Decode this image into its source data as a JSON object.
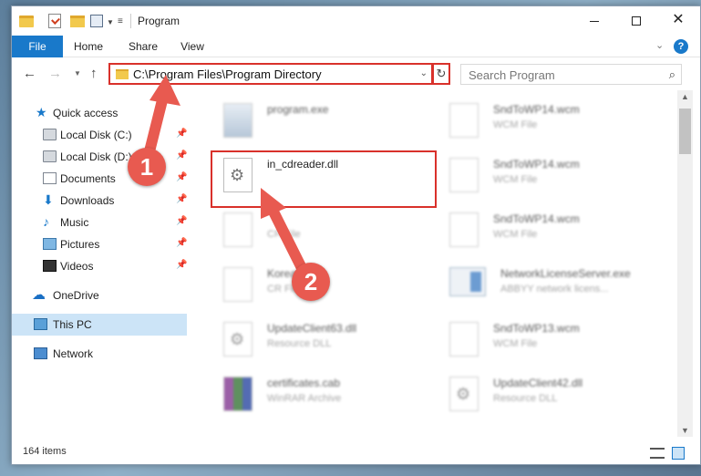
{
  "window": {
    "title": "Program"
  },
  "ribbon": {
    "tabs": [
      "File",
      "Home",
      "Share",
      "View"
    ]
  },
  "nav": {
    "address": "C:\\Program Files\\Program Directory",
    "search_placeholder": "Search Program"
  },
  "sidebar": {
    "items": [
      {
        "label": "Quick access"
      },
      {
        "label": "Local Disk (C:)"
      },
      {
        "label": "Local Disk (D:)"
      },
      {
        "label": "Documents"
      },
      {
        "label": "Downloads"
      },
      {
        "label": "Music"
      },
      {
        "label": "Pictures"
      },
      {
        "label": "Videos"
      },
      {
        "label": "OneDrive"
      },
      {
        "label": "This PC"
      },
      {
        "label": "Network"
      }
    ]
  },
  "files": [
    {
      "name": "program.exe",
      "type": ""
    },
    {
      "name": "SndToWP14.wcm",
      "type": "WCM File"
    },
    {
      "name": "in_cdreader.dll",
      "type": ""
    },
    {
      "name": "SndToWP14.wcm",
      "type": "WCM File"
    },
    {
      "name": "",
      "type": "CR File"
    },
    {
      "name": "SndToWP14.wcm",
      "type": "WCM File"
    },
    {
      "name": "Korean",
      "type": "CR File"
    },
    {
      "name": "NetworkLicenseServer.exe",
      "type": "ABBYY network licens..."
    },
    {
      "name": "UpdateClient63.dll",
      "type": "Resource DLL"
    },
    {
      "name": "SndToWP13.wcm",
      "type": "WCM File"
    },
    {
      "name": "certificates.cab",
      "type": "WinRAR Archive"
    },
    {
      "name": "UpdateClient42.dll",
      "type": "Resource DLL"
    }
  ],
  "status": {
    "items_count": "164 items"
  },
  "annotations": {
    "step1": "1",
    "step2": "2",
    "color": "#e85a50"
  }
}
